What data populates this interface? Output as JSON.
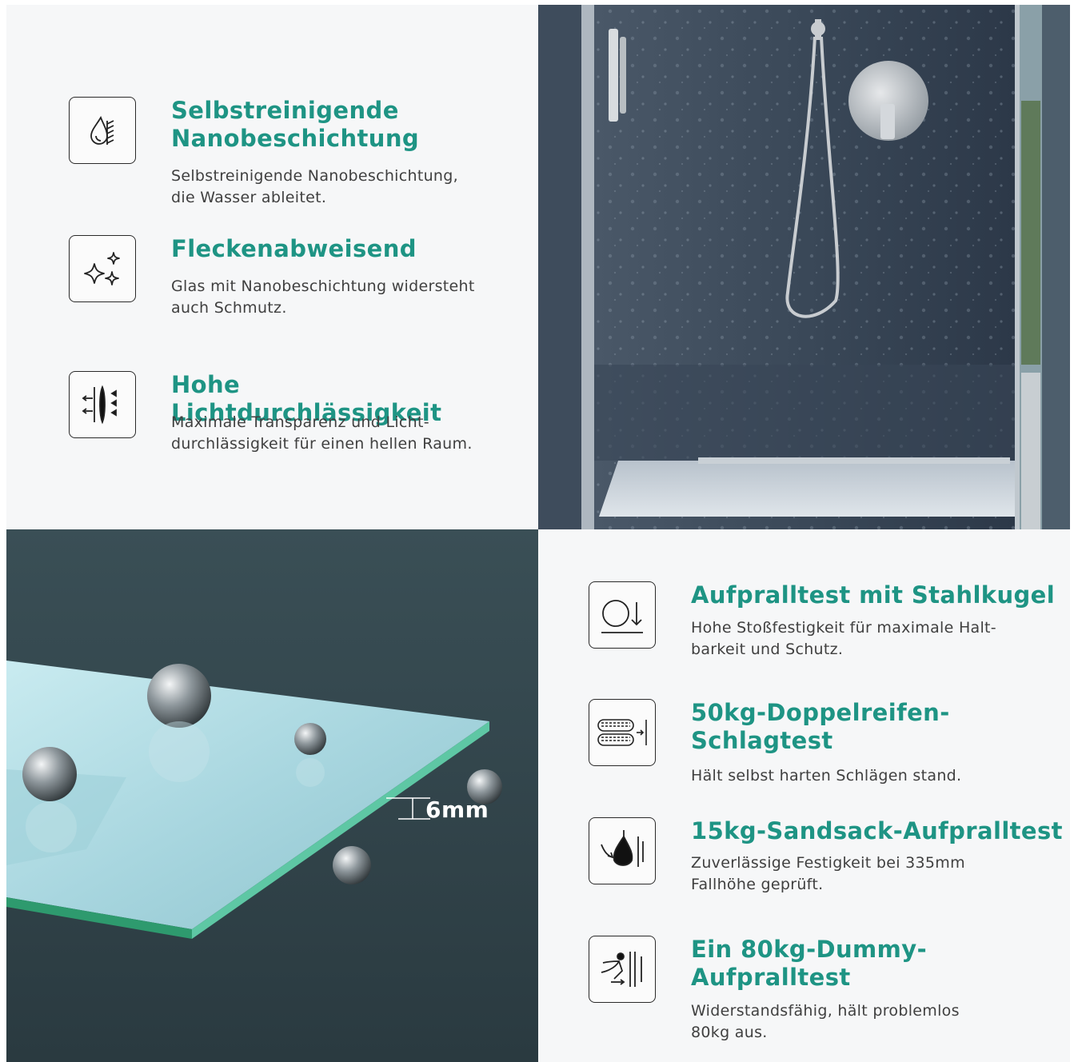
{
  "top_features": [
    {
      "title": "Selbstreinigende\nNanobeschichtung",
      "text": "Selbstreinigende Nanobeschichtung,\ndie Wasser ableitet.",
      "icon": "water-repel-icon"
    },
    {
      "title": "Fleckenabweisend",
      "text": "Glas mit Nanobeschichtung widersteht\nauch Schmutz.",
      "icon": "sparkle-icon"
    },
    {
      "title": "Hohe Lichtdurchlässigkeit",
      "text": "Maximale Transparenz und Licht-\ndurchlässigkeit für einen hellen Raum.",
      "icon": "light-transmission-icon"
    }
  ],
  "bottom_features": [
    {
      "title": "Aufpralltest mit Stahlkugel",
      "text": "Hohe Stoßfestigkeit für maximale Halt-\nbarkeit und Schutz.",
      "icon": "steel-ball-drop-icon"
    },
    {
      "title": "50kg-Doppelreifen-\nSchlagtest",
      "text": "Hält selbst harten Schlägen stand.",
      "icon": "double-tire-icon"
    },
    {
      "title": "15kg-Sandsack-Aufpralltest",
      "text": "Zuverlässige Festigkeit bei 335mm\nFallhöhe geprüft.",
      "icon": "sandbag-icon"
    },
    {
      "title": "Ein 80kg-Dummy-\nAufpralltest",
      "text": "Widerstandsfähig, hält problemlos\n80kg aus.",
      "icon": "dummy-impact-icon"
    }
  ],
  "glass_thickness_label": "6mm",
  "colors": {
    "accent": "#1e9484",
    "panel_bg": "#f6f7f8",
    "text": "#404040"
  }
}
